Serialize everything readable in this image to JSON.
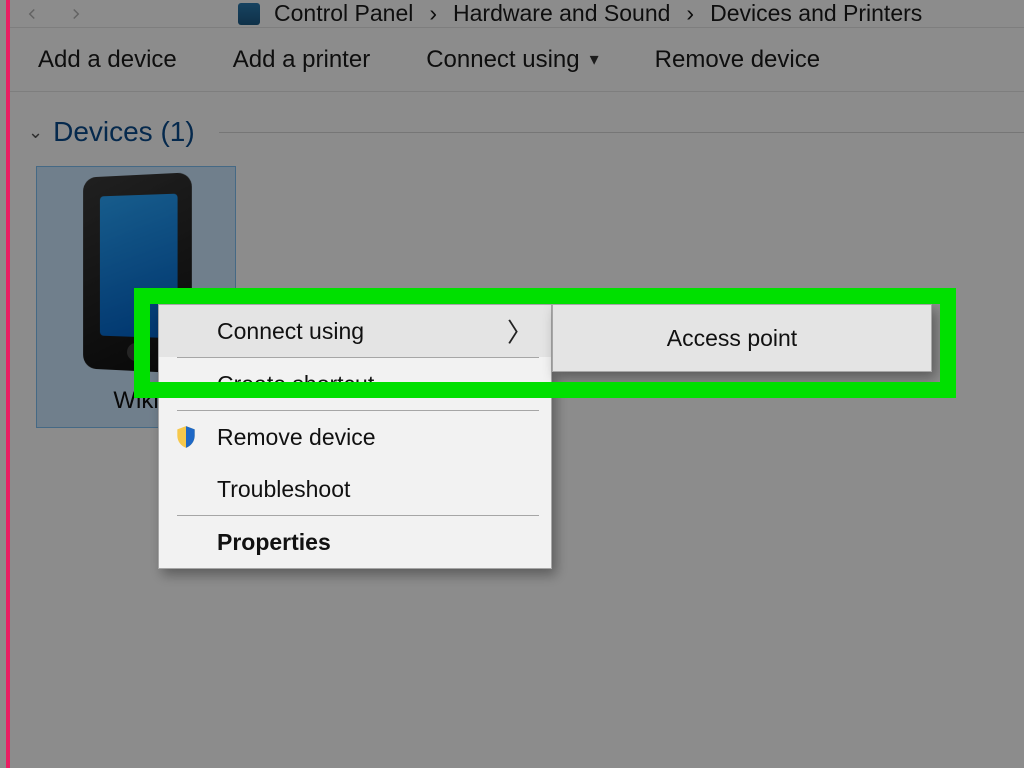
{
  "breadcrumb": {
    "item0": "Control Panel",
    "item1": "Hardware and Sound",
    "item2": "Devices and Printers"
  },
  "toolbar": {
    "add_device": "Add a device",
    "add_printer": "Add a printer",
    "connect_using": "Connect using",
    "remove_device": "Remove device"
  },
  "section": {
    "title": "Devices (1)"
  },
  "device": {
    "label": "Wiki"
  },
  "context_menu": {
    "connect_using": "Connect using",
    "create_shortcut": "Create shortcut",
    "remove_device": "Remove device",
    "troubleshoot": "Troubleshoot",
    "properties": "Properties"
  },
  "submenu": {
    "access_point": "Access point"
  }
}
